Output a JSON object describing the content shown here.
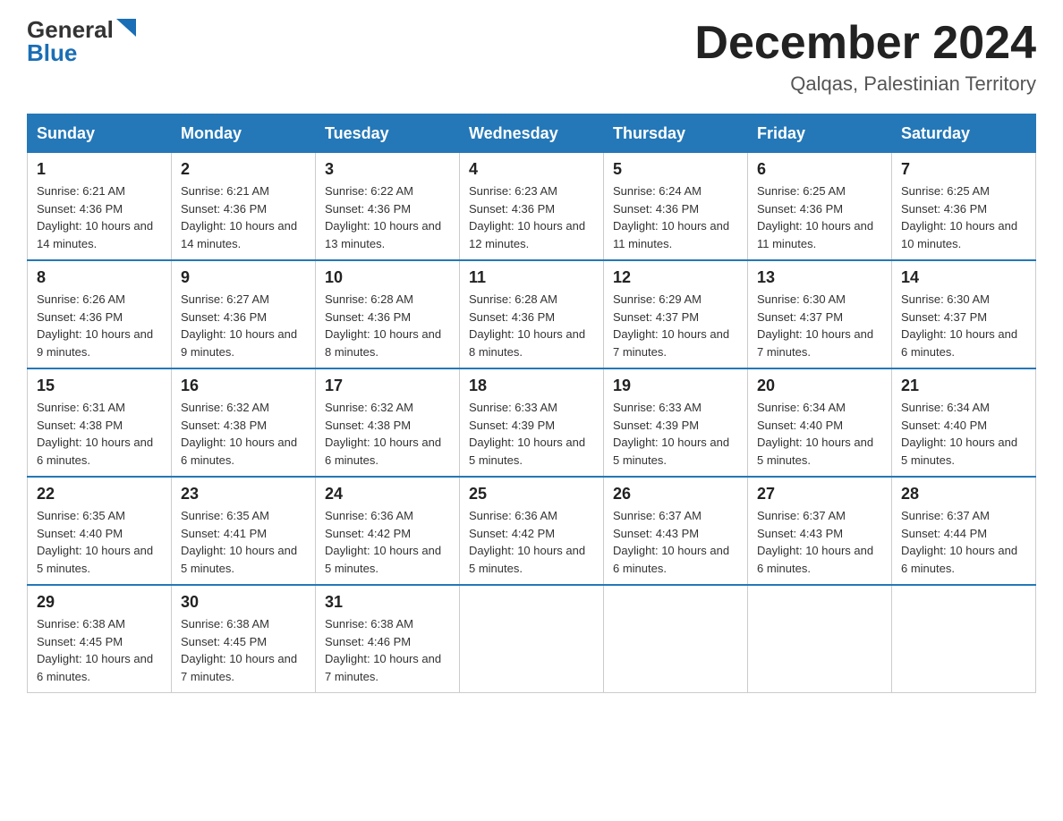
{
  "logo": {
    "general": "General",
    "blue": "Blue",
    "triangle": "▶"
  },
  "title": "December 2024",
  "subtitle": "Qalqas, Palestinian Territory",
  "days": [
    "Sunday",
    "Monday",
    "Tuesday",
    "Wednesday",
    "Thursday",
    "Friday",
    "Saturday"
  ],
  "weeks": [
    [
      {
        "num": "1",
        "sunrise": "6:21 AM",
        "sunset": "4:36 PM",
        "daylight": "10 hours and 14 minutes."
      },
      {
        "num": "2",
        "sunrise": "6:21 AM",
        "sunset": "4:36 PM",
        "daylight": "10 hours and 14 minutes."
      },
      {
        "num": "3",
        "sunrise": "6:22 AM",
        "sunset": "4:36 PM",
        "daylight": "10 hours and 13 minutes."
      },
      {
        "num": "4",
        "sunrise": "6:23 AM",
        "sunset": "4:36 PM",
        "daylight": "10 hours and 12 minutes."
      },
      {
        "num": "5",
        "sunrise": "6:24 AM",
        "sunset": "4:36 PM",
        "daylight": "10 hours and 11 minutes."
      },
      {
        "num": "6",
        "sunrise": "6:25 AM",
        "sunset": "4:36 PM",
        "daylight": "10 hours and 11 minutes."
      },
      {
        "num": "7",
        "sunrise": "6:25 AM",
        "sunset": "4:36 PM",
        "daylight": "10 hours and 10 minutes."
      }
    ],
    [
      {
        "num": "8",
        "sunrise": "6:26 AM",
        "sunset": "4:36 PM",
        "daylight": "10 hours and 9 minutes."
      },
      {
        "num": "9",
        "sunrise": "6:27 AM",
        "sunset": "4:36 PM",
        "daylight": "10 hours and 9 minutes."
      },
      {
        "num": "10",
        "sunrise": "6:28 AM",
        "sunset": "4:36 PM",
        "daylight": "10 hours and 8 minutes."
      },
      {
        "num": "11",
        "sunrise": "6:28 AM",
        "sunset": "4:36 PM",
        "daylight": "10 hours and 8 minutes."
      },
      {
        "num": "12",
        "sunrise": "6:29 AM",
        "sunset": "4:37 PM",
        "daylight": "10 hours and 7 minutes."
      },
      {
        "num": "13",
        "sunrise": "6:30 AM",
        "sunset": "4:37 PM",
        "daylight": "10 hours and 7 minutes."
      },
      {
        "num": "14",
        "sunrise": "6:30 AM",
        "sunset": "4:37 PM",
        "daylight": "10 hours and 6 minutes."
      }
    ],
    [
      {
        "num": "15",
        "sunrise": "6:31 AM",
        "sunset": "4:38 PM",
        "daylight": "10 hours and 6 minutes."
      },
      {
        "num": "16",
        "sunrise": "6:32 AM",
        "sunset": "4:38 PM",
        "daylight": "10 hours and 6 minutes."
      },
      {
        "num": "17",
        "sunrise": "6:32 AM",
        "sunset": "4:38 PM",
        "daylight": "10 hours and 6 minutes."
      },
      {
        "num": "18",
        "sunrise": "6:33 AM",
        "sunset": "4:39 PM",
        "daylight": "10 hours and 5 minutes."
      },
      {
        "num": "19",
        "sunrise": "6:33 AM",
        "sunset": "4:39 PM",
        "daylight": "10 hours and 5 minutes."
      },
      {
        "num": "20",
        "sunrise": "6:34 AM",
        "sunset": "4:40 PM",
        "daylight": "10 hours and 5 minutes."
      },
      {
        "num": "21",
        "sunrise": "6:34 AM",
        "sunset": "4:40 PM",
        "daylight": "10 hours and 5 minutes."
      }
    ],
    [
      {
        "num": "22",
        "sunrise": "6:35 AM",
        "sunset": "4:40 PM",
        "daylight": "10 hours and 5 minutes."
      },
      {
        "num": "23",
        "sunrise": "6:35 AM",
        "sunset": "4:41 PM",
        "daylight": "10 hours and 5 minutes."
      },
      {
        "num": "24",
        "sunrise": "6:36 AM",
        "sunset": "4:42 PM",
        "daylight": "10 hours and 5 minutes."
      },
      {
        "num": "25",
        "sunrise": "6:36 AM",
        "sunset": "4:42 PM",
        "daylight": "10 hours and 5 minutes."
      },
      {
        "num": "26",
        "sunrise": "6:37 AM",
        "sunset": "4:43 PM",
        "daylight": "10 hours and 6 minutes."
      },
      {
        "num": "27",
        "sunrise": "6:37 AM",
        "sunset": "4:43 PM",
        "daylight": "10 hours and 6 minutes."
      },
      {
        "num": "28",
        "sunrise": "6:37 AM",
        "sunset": "4:44 PM",
        "daylight": "10 hours and 6 minutes."
      }
    ],
    [
      {
        "num": "29",
        "sunrise": "6:38 AM",
        "sunset": "4:45 PM",
        "daylight": "10 hours and 6 minutes."
      },
      {
        "num": "30",
        "sunrise": "6:38 AM",
        "sunset": "4:45 PM",
        "daylight": "10 hours and 7 minutes."
      },
      {
        "num": "31",
        "sunrise": "6:38 AM",
        "sunset": "4:46 PM",
        "daylight": "10 hours and 7 minutes."
      },
      null,
      null,
      null,
      null
    ]
  ]
}
